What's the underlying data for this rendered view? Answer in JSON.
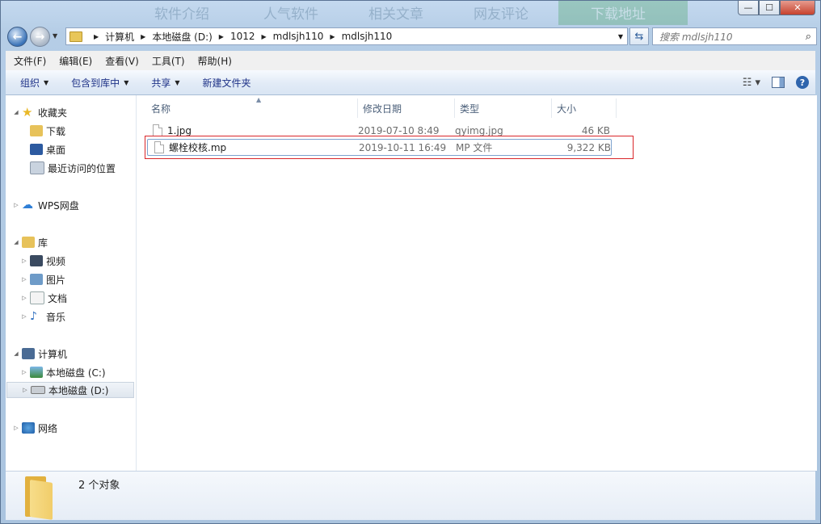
{
  "background_bleed": [
    "软件介绍",
    "人气软件",
    "相关文章",
    "网友评论",
    "下载地址"
  ],
  "window_buttons": {
    "minimize": "—",
    "maximize": "☐",
    "close": "✕"
  },
  "address": {
    "crumbs": [
      "计算机",
      "本地磁盘 (D:)",
      "1012",
      "mdlsjh110",
      "mdlsjh110"
    ]
  },
  "search": {
    "placeholder": "搜索 mdlsjh110"
  },
  "menu": [
    "文件(F)",
    "编辑(E)",
    "查看(V)",
    "工具(T)",
    "帮助(H)"
  ],
  "toolbar": {
    "organize": "组织",
    "include_in_library": "包含到库中",
    "share": "共享",
    "new_folder": "新建文件夹"
  },
  "nav": {
    "favorites": "收藏夹",
    "downloads": "下载",
    "desktop": "桌面",
    "recent": "最近访问的位置",
    "wps": "WPS网盘",
    "libraries": "库",
    "videos": "视频",
    "pictures": "图片",
    "documents": "文档",
    "music": "音乐",
    "computer": "计算机",
    "drive_c": "本地磁盘 (C:)",
    "drive_d": "本地磁盘 (D:)",
    "network": "网络"
  },
  "columns": {
    "name": "名称",
    "date": "修改日期",
    "type": "类型",
    "size": "大小"
  },
  "files": [
    {
      "name": "1.jpg",
      "date": "2019-07-10 8:49",
      "type": "qyimg.jpg",
      "size": "46 KB"
    },
    {
      "name": "螺栓校核.mp",
      "date": "2019-10-11 16:49",
      "type": "MP 文件",
      "size": "9,322 KB"
    }
  ],
  "details": {
    "count": "2 个对象"
  },
  "colors": {
    "highlight_box": "#d9262a",
    "link_blue": "#1e3287"
  }
}
